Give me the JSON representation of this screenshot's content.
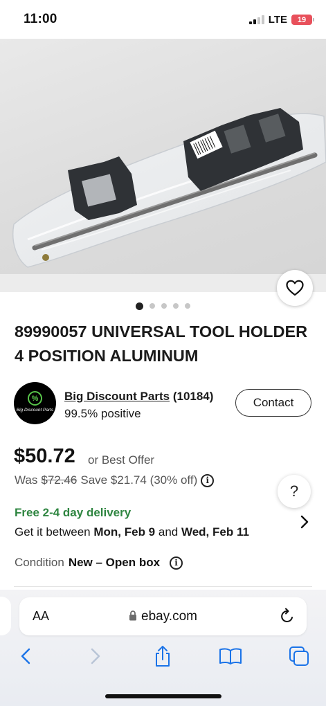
{
  "status_bar": {
    "time": "11:00",
    "network": "LTE",
    "battery": "19"
  },
  "gallery": {
    "image_count": 5,
    "active_index": 0
  },
  "listing": {
    "title": "89990057 UNIVERSAL TOOL HOLDER 4 POSITION ALUMINUM"
  },
  "seller": {
    "logo_text": "Big Discount Parts",
    "logo_mark": "%",
    "name": "Big Discount Parts",
    "feedback_count": "(10184)",
    "feedback_percent": "99.5% positive",
    "contact_label": "Contact"
  },
  "pricing": {
    "price": "$50.72",
    "best_offer": "or Best Offer",
    "was_label": "Was",
    "was_price": "$72.46",
    "save_text": "Save $21.74 (30% off)"
  },
  "help": {
    "label": "?"
  },
  "shipping": {
    "headline": "Free 2-4 day delivery",
    "prefix": "Get it between",
    "start": "Mon, Feb 9",
    "conj": "and",
    "end": "Wed, Feb 11"
  },
  "condition": {
    "label": "Condition",
    "value": "New – Open box"
  },
  "browser": {
    "text_size_label": "AA",
    "url": "ebay.com"
  },
  "colors": {
    "delivery_green": "#2e8540",
    "accent_blue": "#1a73e8"
  }
}
